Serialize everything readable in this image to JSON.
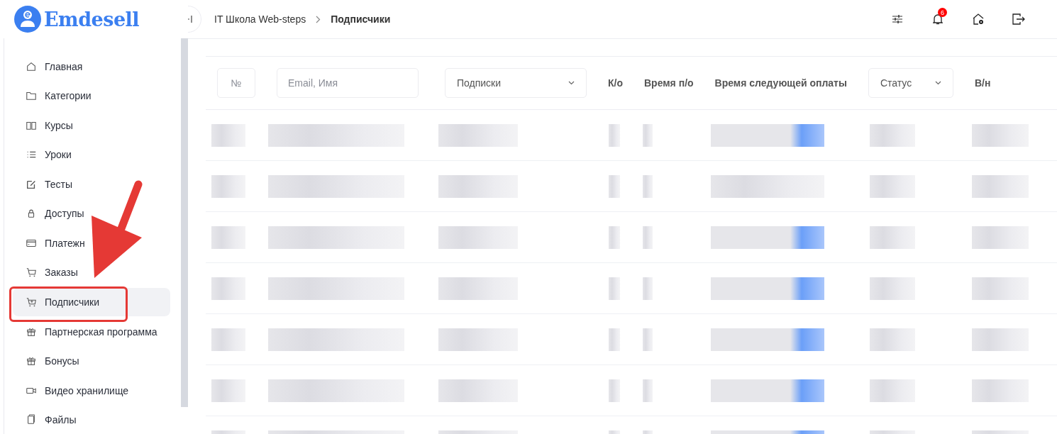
{
  "logo": {
    "text": "Emdesell"
  },
  "sidebar": {
    "items": [
      {
        "label": "Главная",
        "selected": false
      },
      {
        "label": "Категории",
        "selected": false
      },
      {
        "label": "Курсы",
        "selected": false
      },
      {
        "label": "Уроки",
        "selected": false
      },
      {
        "label": "Тесты",
        "selected": false
      },
      {
        "label": "Доступы",
        "selected": false
      },
      {
        "label": "Платежн",
        "selected": false
      },
      {
        "label": "Заказы",
        "selected": false
      },
      {
        "label": "Подписчики",
        "selected": true
      },
      {
        "label": "Партнерская программа",
        "selected": false
      },
      {
        "label": "Бонусы",
        "selected": false
      },
      {
        "label": "Видео хранилище",
        "selected": false
      },
      {
        "label": "Файлы",
        "selected": false
      }
    ]
  },
  "breadcrumb": [
    {
      "label": "IT Школа Web-steps",
      "current": false
    },
    {
      "label": "Подписчики",
      "current": true
    }
  ],
  "header": {
    "notifications_badge": "6"
  },
  "table": {
    "filters": [
      {
        "kind": "input",
        "placeholder": "№"
      },
      {
        "kind": "input",
        "placeholder": "Email, Имя"
      },
      {
        "kind": "select",
        "value": "Подписки"
      },
      {
        "kind": "heading",
        "label": "К/о"
      },
      {
        "kind": "heading",
        "label": "Время п/о"
      },
      {
        "kind": "heading",
        "label": "Время следующей оплаты"
      },
      {
        "kind": "select",
        "value": "Статус"
      },
      {
        "kind": "heading",
        "label": "В/н"
      }
    ]
  }
}
